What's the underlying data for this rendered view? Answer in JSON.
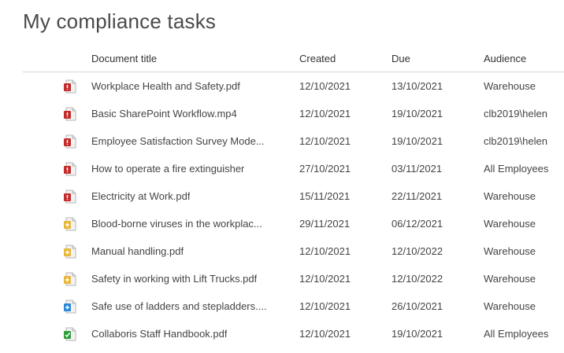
{
  "page": {
    "title": "My compliance tasks"
  },
  "columns": {
    "title": "Document title",
    "created": "Created",
    "due": "Due",
    "audience": "Audience"
  },
  "colors": {
    "overdue": "#c42b2b",
    "due_soon": "#e8b73a",
    "upcoming": "#2b88d8",
    "complete": "#2e9e3a"
  },
  "rows": [
    {
      "title": "Workplace Health and Safety.pdf",
      "created": "12/10/2021",
      "due": "13/10/2021",
      "audience": "Warehouse",
      "status": "overdue",
      "icon": "document-overdue-icon"
    },
    {
      "title": "Basic SharePoint Workflow.mp4",
      "created": "12/10/2021",
      "due": "19/10/2021",
      "audience": "clb2019\\helen",
      "status": "overdue",
      "icon": "document-overdue-icon"
    },
    {
      "title": "Employee Satisfaction Survey Mode...",
      "created": "12/10/2021",
      "due": "19/10/2021",
      "audience": "clb2019\\helen",
      "status": "overdue",
      "icon": "document-overdue-icon"
    },
    {
      "title": "How to operate a fire extinguisher",
      "created": "27/10/2021",
      "due": "03/11/2021",
      "audience": "All Employees",
      "status": "overdue",
      "icon": "document-overdue-icon"
    },
    {
      "title": "Electricity at Work.pdf",
      "created": "15/11/2021",
      "due": "22/11/2021",
      "audience": "Warehouse",
      "status": "overdue",
      "icon": "document-overdue-icon"
    },
    {
      "title": "Blood-borne viruses in the workplac...",
      "created": "29/11/2021",
      "due": "06/12/2021",
      "audience": "Warehouse",
      "status": "due_soon",
      "icon": "document-pending-icon"
    },
    {
      "title": "Manual handling.pdf",
      "created": "12/10/2021",
      "due": "12/10/2022",
      "audience": "Warehouse",
      "status": "due_soon",
      "icon": "document-pending-icon"
    },
    {
      "title": "Safety in working with Lift Trucks.pdf",
      "created": "12/10/2021",
      "due": "12/10/2022",
      "audience": "Warehouse",
      "status": "due_soon",
      "icon": "document-pending-icon"
    },
    {
      "title": "Safe use of ladders and stepladders....",
      "created": "12/10/2021",
      "due": "26/10/2021",
      "audience": "Warehouse",
      "status": "upcoming",
      "icon": "document-upcoming-icon"
    },
    {
      "title": "Collaboris Staff Handbook.pdf",
      "created": "12/10/2021",
      "due": "19/10/2021",
      "audience": "All Employees",
      "status": "complete",
      "icon": "document-complete-icon"
    }
  ]
}
